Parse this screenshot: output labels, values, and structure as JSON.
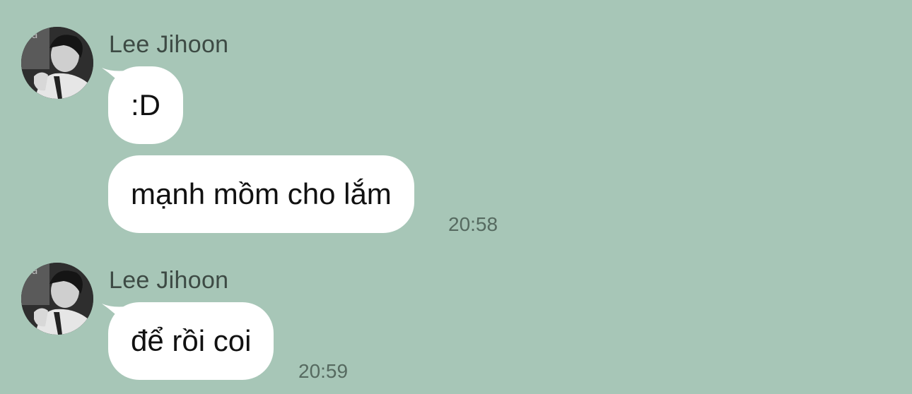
{
  "theme": {
    "background": "#a7c6b7",
    "bubble": "#ffffff",
    "name_color": "#3d4a44",
    "time_color": "#566a60"
  },
  "messages": [
    {
      "sender": "Lee Jihoon",
      "avatar_icon": "profile-photo",
      "bubbles": [
        ":D",
        "mạnh mồm cho lắm"
      ],
      "time": "20:58"
    },
    {
      "sender": "Lee Jihoon",
      "avatar_icon": "profile-photo",
      "bubbles": [
        "để rồi coi"
      ],
      "time": "20:59"
    }
  ]
}
